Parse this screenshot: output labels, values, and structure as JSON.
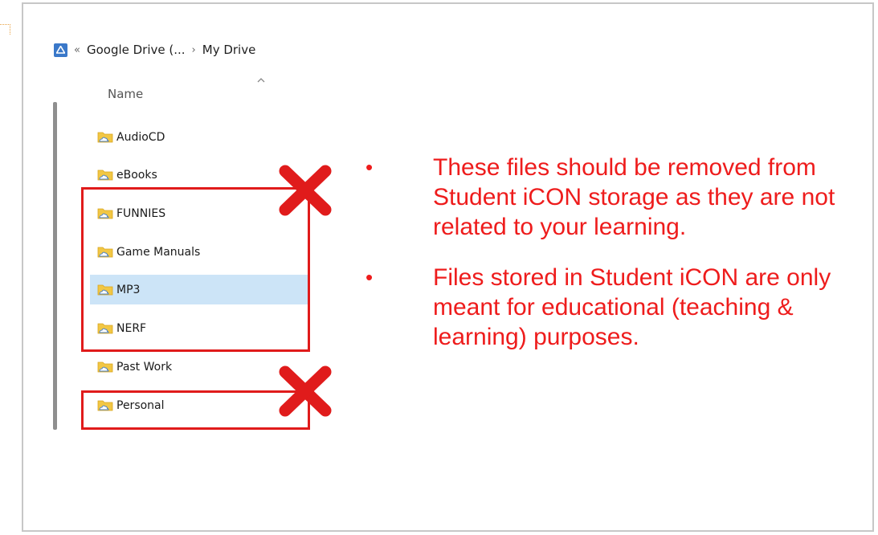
{
  "breadcrumb": {
    "separator_start": "«",
    "location": "Google Drive (...",
    "separator": "›",
    "current": "My Drive",
    "icon": "google-drive-icon"
  },
  "list": {
    "column_header": "Name",
    "sort_icon": "chevron-up-icon",
    "folder_icon": "folder-cloud-icon",
    "items": [
      {
        "label": "AudioCD",
        "selected": false
      },
      {
        "label": "eBooks",
        "selected": false
      },
      {
        "label": "FUNNIES",
        "selected": false
      },
      {
        "label": "Game Manuals",
        "selected": false
      },
      {
        "label": "MP3",
        "selected": true
      },
      {
        "label": "NERF",
        "selected": false
      },
      {
        "label": "Past Work",
        "selected": false
      },
      {
        "label": "Personal",
        "selected": false
      }
    ]
  },
  "annotations": {
    "mark_icon": "red-x-icon",
    "color": "#e01b1b",
    "bullet_symbol": "•",
    "bullets": [
      "These files should be removed from Student iCON storage as they are not related to your learning.",
      "Files stored in Student iCON are only meant for educational (teaching & learning) purposes."
    ]
  },
  "colors": {
    "selected_row": "#cce4f7",
    "text_red": "#ee1c1c",
    "folder": "#f2c744"
  }
}
